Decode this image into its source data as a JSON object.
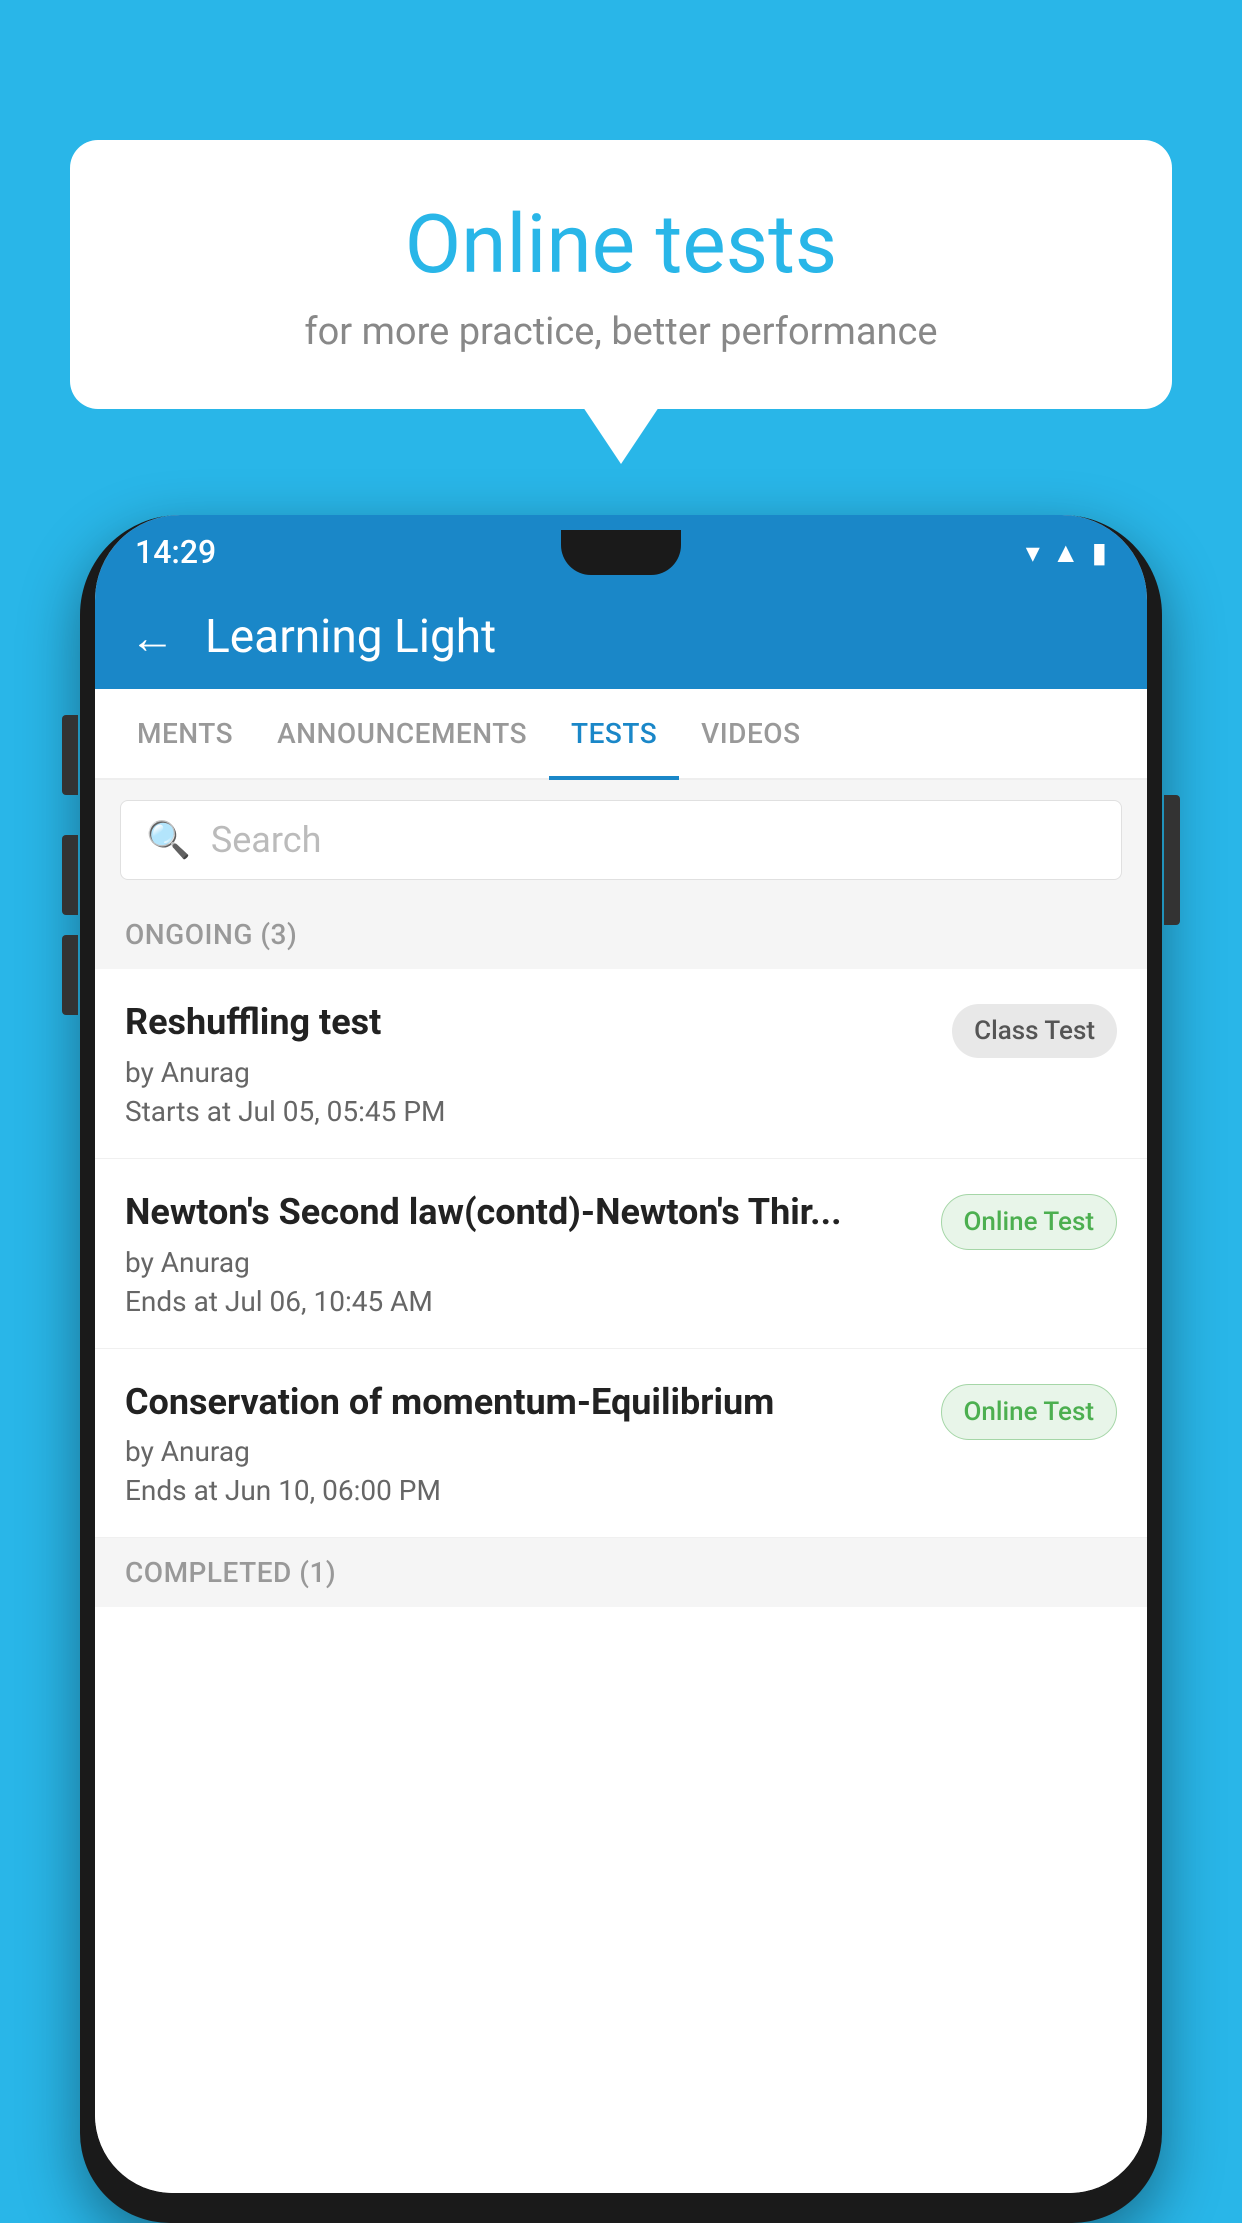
{
  "background": {
    "color": "#29b6e8"
  },
  "bubble": {
    "title": "Online tests",
    "subtitle": "for more practice, better performance"
  },
  "status_bar": {
    "time": "14:29",
    "icons": [
      "wifi",
      "signal",
      "battery"
    ]
  },
  "app_header": {
    "title": "Learning Light",
    "back_label": "←"
  },
  "tabs": [
    {
      "label": "MENTS",
      "active": false
    },
    {
      "label": "ANNOUNCEMENTS",
      "active": false
    },
    {
      "label": "TESTS",
      "active": true
    },
    {
      "label": "VIDEOS",
      "active": false
    }
  ],
  "search": {
    "placeholder": "Search"
  },
  "ongoing_section": {
    "label": "ONGOING (3)"
  },
  "tests": [
    {
      "name": "Reshuffling test",
      "author": "by Anurag",
      "date": "Starts at  Jul 05, 05:45 PM",
      "badge": "Class Test",
      "badge_type": "class"
    },
    {
      "name": "Newton's Second law(contd)-Newton's Thir...",
      "author": "by Anurag",
      "date": "Ends at  Jul 06, 10:45 AM",
      "badge": "Online Test",
      "badge_type": "online"
    },
    {
      "name": "Conservation of momentum-Equilibrium",
      "author": "by Anurag",
      "date": "Ends at  Jun 10, 06:00 PM",
      "badge": "Online Test",
      "badge_type": "online"
    }
  ],
  "completed_section": {
    "label": "COMPLETED (1)"
  }
}
